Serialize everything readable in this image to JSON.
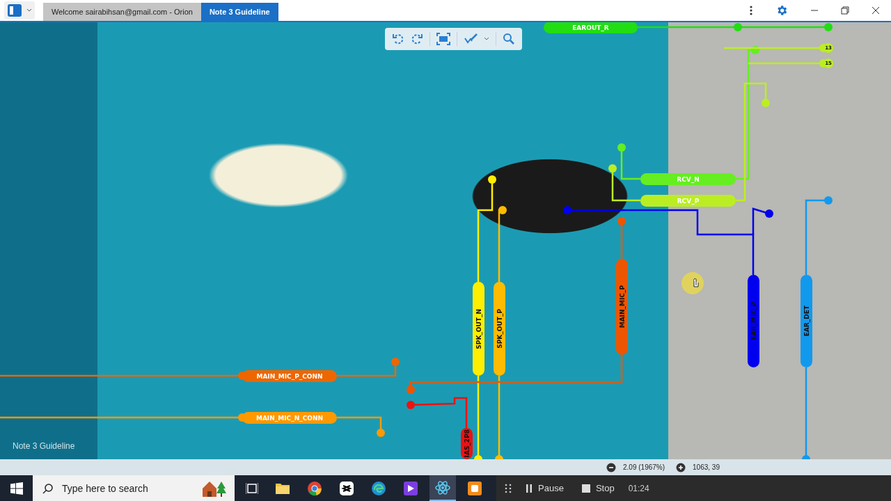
{
  "window": {
    "tabs": [
      {
        "label": "Welcome sairabihsan@gmail.com - Orion",
        "selected": false
      },
      {
        "label": "Note 3 Guideline",
        "selected": true
      }
    ]
  },
  "viewer": {
    "board_label": "Note 3 Guideline",
    "nets": [
      {
        "kind": "horizontal",
        "label": "EAROUT_R",
        "color": "#22dd11"
      },
      {
        "kind": "horizontal",
        "label": "RCV_N",
        "color": "#66ee22"
      },
      {
        "kind": "horizontal",
        "label": "RCV_P",
        "color": "#bbee22"
      },
      {
        "kind": "vertical",
        "label": "SPK_OUT_N",
        "color": "#ffee00"
      },
      {
        "kind": "vertical",
        "label": "SPK_OUT_P",
        "color": "#ffbb00"
      },
      {
        "kind": "vertical",
        "label": "MAIN_MIC_P",
        "color": "#ee5500"
      },
      {
        "kind": "vertical",
        "label": "EAR_MIC_P",
        "color": "#0000ee"
      },
      {
        "kind": "vertical",
        "label": "EAR_DET",
        "color": "#1199ee"
      },
      {
        "kind": "horizontal",
        "label": "MAIN_MIC_P_CONN",
        "color": "#ee6600"
      },
      {
        "kind": "horizontal",
        "label": "MAIN_MIC_N_CONN",
        "color": "#ff9900"
      },
      {
        "kind": "vertical",
        "label": "IAS_2P8",
        "color": "#ee1111"
      },
      {
        "kind": "pin",
        "label": "13",
        "color": "#bbee22"
      },
      {
        "kind": "pin",
        "label": "15",
        "color": "#bbee22"
      }
    ]
  },
  "status_bar": {
    "zoom": "2.09 (1967%)",
    "coordinates": "1063, 39"
  },
  "taskbar": {
    "search": {
      "placeholder": "Type here to search"
    },
    "recorder": {
      "pause": "Pause",
      "stop": "Stop",
      "time": "01:24"
    }
  }
}
